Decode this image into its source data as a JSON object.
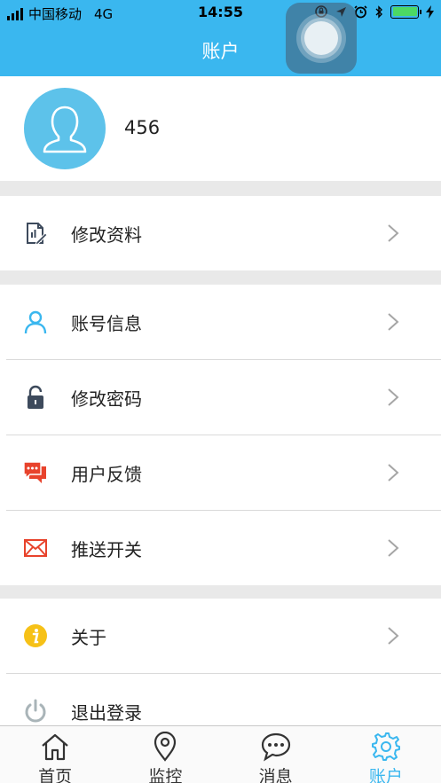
{
  "status_bar": {
    "carrier": "中国移动",
    "network": "4G",
    "time": "14:55"
  },
  "header": {
    "title": "账户"
  },
  "profile": {
    "username": "456"
  },
  "menu": {
    "edit_profile": "修改资料",
    "account_info": "账号信息",
    "change_password": "修改密码",
    "feedback": "用户反馈",
    "push_switch": "推送开关",
    "about": "关于",
    "logout": "退出登录"
  },
  "tabs": [
    {
      "label": "首页",
      "icon": "home-icon"
    },
    {
      "label": "监控",
      "icon": "location-pin-icon"
    },
    {
      "label": "消息",
      "icon": "chat-bubble-icon"
    },
    {
      "label": "账户",
      "icon": "gear-icon",
      "active": true
    }
  ],
  "colors": {
    "accent": "#3ab7ef",
    "avatar": "#5dc2ea",
    "red": "#e8432c",
    "yellow": "#f6c117",
    "dark": "#3d4a5c",
    "gray_icon": "#a9b4b8"
  }
}
